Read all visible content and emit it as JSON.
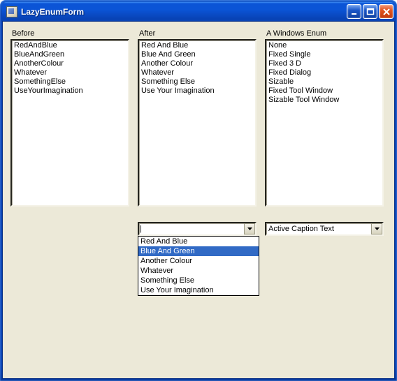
{
  "window": {
    "title": "LazyEnumForm"
  },
  "columns": {
    "before": {
      "label": "Before",
      "items": [
        "RedAndBlue",
        "BlueAndGreen",
        "AnotherColour",
        "Whatever",
        "SomethingElse",
        "UseYourImagination"
      ]
    },
    "after": {
      "label": "After",
      "items": [
        "Red And Blue",
        "Blue And Green",
        "Another Colour",
        "Whatever",
        "Something Else",
        "Use Your Imagination"
      ]
    },
    "winenum": {
      "label": "A Windows Enum",
      "items": [
        "None",
        "Fixed Single",
        "Fixed 3 D",
        "Fixed Dialog",
        "Sizable",
        "Fixed Tool Window",
        "Sizable Tool Window"
      ]
    }
  },
  "combo_after": {
    "value": "",
    "options": [
      "Red And Blue",
      "Blue And Green",
      "Another Colour",
      "Whatever",
      "Something Else",
      "Use Your Imagination"
    ],
    "highlighted_index": 1
  },
  "combo_winenum": {
    "value": "Active Caption Text"
  }
}
